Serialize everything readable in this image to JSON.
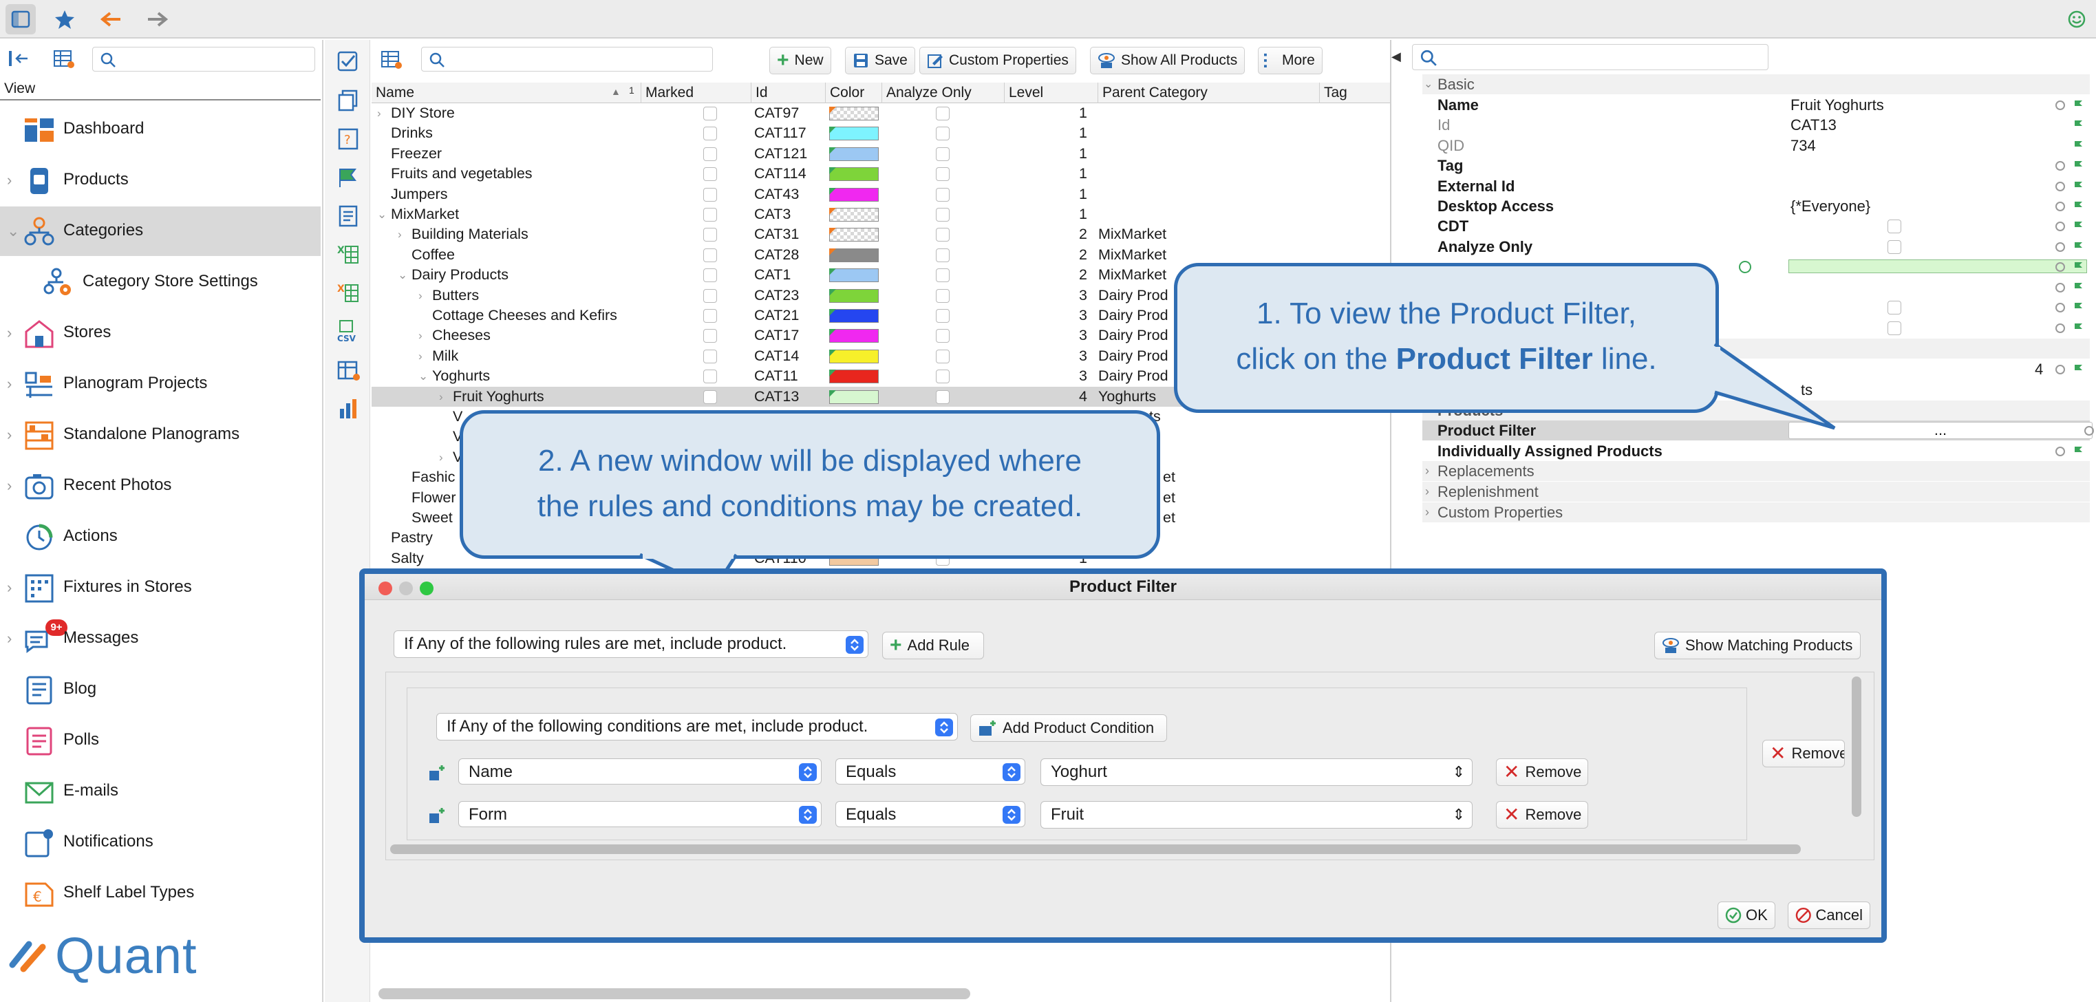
{
  "sidebar": {
    "view_label": "View",
    "items": [
      {
        "label": "Dashboard",
        "icon": "dashboard-icon"
      },
      {
        "label": "Products",
        "icon": "products-icon"
      },
      {
        "label": "Categories",
        "icon": "categories-icon"
      },
      {
        "label": "Category Store Settings",
        "icon": "category-store-settings-icon"
      },
      {
        "label": "Stores",
        "icon": "stores-icon"
      },
      {
        "label": "Planogram Projects",
        "icon": "planogram-projects-icon"
      },
      {
        "label": "Standalone Planograms",
        "icon": "standalone-planograms-icon"
      },
      {
        "label": "Recent Photos",
        "icon": "camera-icon"
      },
      {
        "label": "Actions",
        "icon": "actions-icon"
      },
      {
        "label": "Fixtures in Stores",
        "icon": "fixtures-icon"
      },
      {
        "label": "Messages",
        "icon": "messages-icon",
        "badge": "9+"
      },
      {
        "label": "Blog",
        "icon": "blog-icon"
      },
      {
        "label": "Polls",
        "icon": "polls-icon"
      },
      {
        "label": "E-mails",
        "icon": "email-icon"
      },
      {
        "label": "Notifications",
        "icon": "notifications-icon"
      },
      {
        "label": "Shelf Label Types",
        "icon": "shelf-label-icon"
      }
    ],
    "logo_text": "Quant"
  },
  "toolbar": {
    "new_label": "New",
    "save_label": "Save",
    "custom_properties_label": "Custom Properties",
    "show_all_products_label": "Show All Products",
    "more_label": "More"
  },
  "grid": {
    "columns": [
      "Name",
      "Marked",
      "Id",
      "Color",
      "Analyze Only",
      "Level",
      "Parent Category",
      "Tag"
    ],
    "sort_indicator": "1",
    "rows": [
      {
        "name": "DIY Store",
        "id": "CAT97",
        "level": "1",
        "parent": "",
        "color": "checker"
      },
      {
        "name": "Drinks",
        "id": "CAT117",
        "level": "1",
        "parent": "",
        "color": "#7ef3ff"
      },
      {
        "name": "Freezer",
        "id": "CAT121",
        "level": "1",
        "parent": "",
        "color": "#9cc8f3"
      },
      {
        "name": "Fruits and vegetables",
        "id": "CAT114",
        "level": "1",
        "parent": "",
        "color": "#7ed43a"
      },
      {
        "name": "Jumpers",
        "id": "CAT43",
        "level": "1",
        "parent": "",
        "color": "#f028f0"
      },
      {
        "name": "MixMarket",
        "id": "CAT3",
        "level": "1",
        "parent": "",
        "color": "checker"
      },
      {
        "name": "Building Materials",
        "id": "CAT31",
        "level": "2",
        "parent": "MixMarket",
        "color": "checker"
      },
      {
        "name": "Coffee",
        "id": "CAT28",
        "level": "2",
        "parent": "MixMarket",
        "color": "#8a8a8a"
      },
      {
        "name": "Dairy Products",
        "id": "CAT1",
        "level": "2",
        "parent": "MixMarket",
        "color": "#9cc8f3"
      },
      {
        "name": "Butters",
        "id": "CAT23",
        "level": "3",
        "parent": "Dairy Prod",
        "color": "#7ed43a"
      },
      {
        "name": "Cottage Cheeses and Kefirs",
        "id": "CAT21",
        "level": "3",
        "parent": "Dairy Prod",
        "color": "#2546f0"
      },
      {
        "name": "Cheeses",
        "id": "CAT17",
        "level": "3",
        "parent": "Dairy Prod",
        "color": "#f028f0"
      },
      {
        "name": "Milk",
        "id": "CAT14",
        "level": "3",
        "parent": "Dairy Prod",
        "color": "#f7f02a"
      },
      {
        "name": "Yoghurts",
        "id": "CAT11",
        "level": "3",
        "parent": "Dairy Prod",
        "color": "#e8261e"
      },
      {
        "name": "Fruit Yoghurts",
        "id": "CAT13",
        "level": "4",
        "parent": "Yoghurts",
        "color": "#d7f7d0"
      },
      {
        "name": "V",
        "id": "",
        "level": "",
        "parent": "ts",
        "color": ""
      },
      {
        "name": "V",
        "id": "",
        "level": "",
        "parent": "",
        "color": ""
      },
      {
        "name": "V",
        "id": "",
        "level": "",
        "parent": "",
        "color": ""
      },
      {
        "name": "Fashic",
        "id": "",
        "level": "",
        "parent": "et",
        "color": ""
      },
      {
        "name": "Flower",
        "id": "",
        "level": "",
        "parent": "et",
        "color": ""
      },
      {
        "name": "Sweet",
        "id": "",
        "level": "",
        "parent": "et",
        "color": ""
      },
      {
        "name": "Pastry",
        "id": "",
        "level": "",
        "parent": "",
        "color": ""
      },
      {
        "name": "Salty",
        "id": "CAT110",
        "level": "1",
        "parent": "",
        "color": "#f2c9a0"
      }
    ]
  },
  "properties": {
    "groups": {
      "basic": "Basic",
      "products": "Products",
      "replacements": "Replacements",
      "replenishment": "Replenishment",
      "custom": "Custom Properties"
    },
    "rows": [
      {
        "key": "Name",
        "value": "Fruit Yoghurts",
        "bold": true
      },
      {
        "key": "Id",
        "value": "CAT13",
        "muted": true
      },
      {
        "key": "QID",
        "value": "734",
        "muted": true
      },
      {
        "key": "Tag",
        "value": "",
        "bold": true
      },
      {
        "key": "External Id",
        "value": "",
        "bold": true
      },
      {
        "key": "Desktop Access",
        "value": "{*Everyone}",
        "bold": true
      },
      {
        "key": "CDT",
        "value": "",
        "bold": true
      },
      {
        "key": "Analyze Only",
        "value": "",
        "bold": true
      }
    ],
    "level_value": "4",
    "partial_value": "ts",
    "product_filter_label": "Product Filter",
    "product_filter_value": "...",
    "individually_assigned_label": "Individually Assigned Products"
  },
  "callouts": {
    "one_prefix": "1. To view the Product Filter,",
    "one_line2_start": "click on the ",
    "one_bold": "Product Filter",
    "one_line2_end": " line.",
    "two_line1": "2. A new window will be displayed where",
    "two_line2": "the rules and conditions may be created."
  },
  "dialog": {
    "title": "Product Filter",
    "rule_mode": "If Any of the following rules are met, include product.",
    "add_rule_label": "Add Rule",
    "show_matching_label": "Show Matching Products",
    "condition_mode": "If Any of the following conditions are met, include product.",
    "add_condition_label": "Add Product Condition",
    "conditions": [
      {
        "field": "Name",
        "operator": "Equals",
        "value": "Yoghurt",
        "remove_label": "Remove"
      },
      {
        "field": "Form",
        "operator": "Equals",
        "value": "Fruit",
        "remove_label": "Remove"
      }
    ],
    "rule_remove_label": "Remove",
    "ok_label": "OK",
    "cancel_label": "Cancel"
  },
  "colors": {
    "accent": "#2f6db3",
    "callout_fill": "#dde8f2",
    "spinner_blue": "#3478f6"
  }
}
